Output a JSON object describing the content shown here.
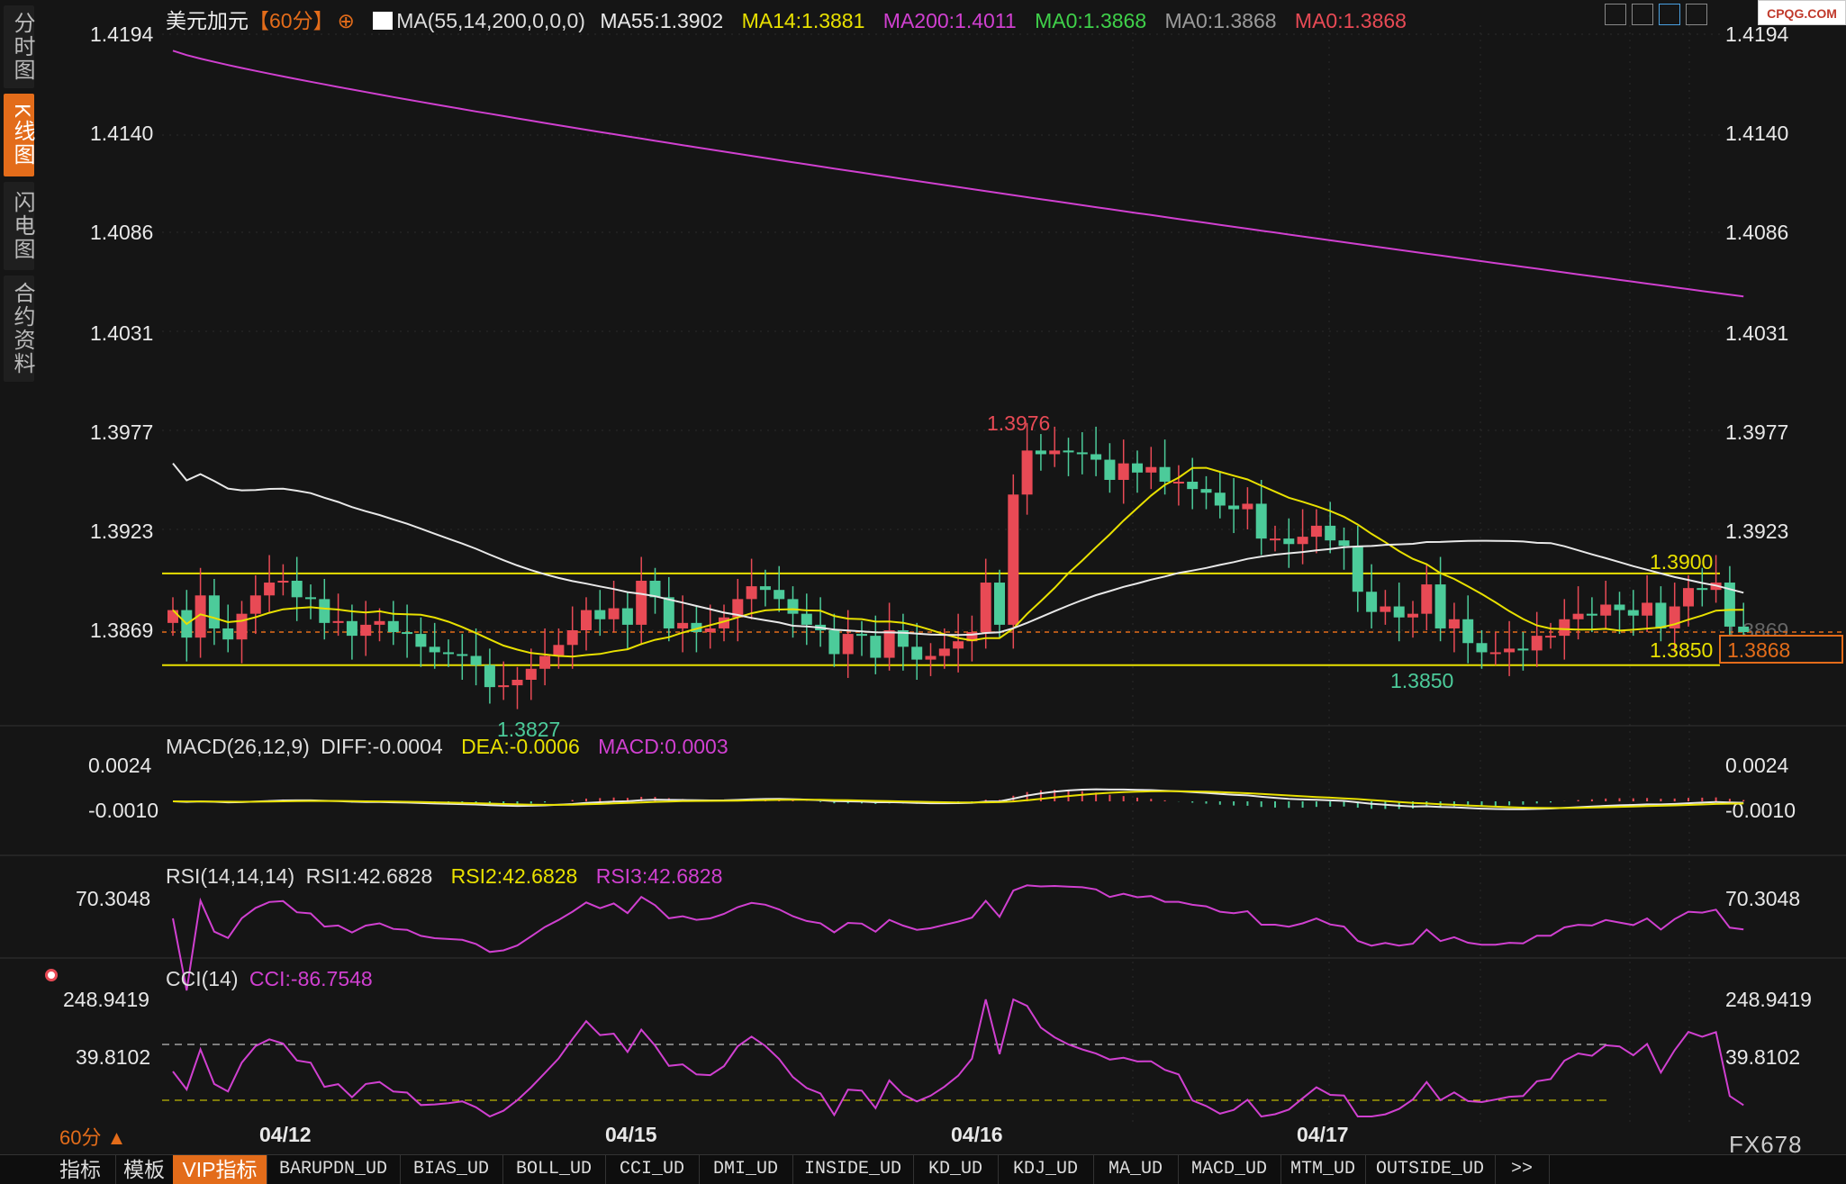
{
  "sidebar": {
    "items": [
      {
        "label": "分时图",
        "active": false
      },
      {
        "label": "K线图",
        "active": true
      },
      {
        "label": "闪电图",
        "active": false
      },
      {
        "label": "合约资料",
        "active": false
      }
    ]
  },
  "header": {
    "symbol": "美元加元",
    "period": "【60分】",
    "ma_params": "MA(55,14,200,0,0,0)",
    "ma55": "MA55:1.3902",
    "ma14": "MA14:1.3881",
    "ma200": "MA200:1.4011",
    "ma0_a": "MA0:1.3868",
    "ma0_b": "MA0:1.3868",
    "ma0_c": "MA0:1.3868"
  },
  "toolbar_icons": [
    "grid-icon",
    "list-icon",
    "chart-toggle-icon",
    "expand-icon"
  ],
  "logo": "CPQG.COM",
  "price_axis": {
    "labels": [
      "1.4194",
      "1.4140",
      "1.4086",
      "1.4031",
      "1.3977",
      "1.3923",
      "1.3869"
    ],
    "values": [
      1.4194,
      1.414,
      1.4086,
      1.4031,
      1.3977,
      1.3923,
      1.3869
    ]
  },
  "annotations": {
    "high": "1.3976",
    "low": "1.3827",
    "low2": "1.3850",
    "line_upper": "1.3900",
    "line_lower": "1.3850",
    "current": "1.3868"
  },
  "macd": {
    "legend": "MACD(26,12,9)",
    "diff": "DIFF:-0.0004",
    "dea": "DEA:-0.0006",
    "macd": "MACD:0.0003",
    "axis": [
      "0.0024",
      "-0.0010"
    ]
  },
  "rsi": {
    "legend": "RSI(14,14,14)",
    "rsi1": "RSI1:42.6828",
    "rsi2": "RSI2:42.6828",
    "rsi3": "RSI3:42.6828",
    "axis": [
      "70.3048"
    ]
  },
  "cci": {
    "legend": "CCI(14)",
    "cci": "CCI:-86.7548",
    "axis": [
      "248.9419",
      "39.8102"
    ]
  },
  "dates": [
    "04/12",
    "04/15",
    "04/16",
    "04/17"
  ],
  "period_label": "60分 ▲",
  "footer_mark": "FX678",
  "tabs": [
    "指标",
    "模板",
    "VIP指标",
    "BARUPDN_UD",
    "BIAS_UD",
    "BOLL_UD",
    "CCI_UD",
    "DMI_UD",
    "INSIDE_UD",
    "KD_UD",
    "KDJ_UD",
    "MA_UD",
    "MACD_UD",
    "MTM_UD",
    "OUTSIDE_UD",
    ">>"
  ],
  "colors": {
    "up": "#e84a55",
    "down": "#4ccb9a",
    "ma14": "#e8e000",
    "ma55": "#e8e8e8",
    "ma200": "#d040d0",
    "accent": "#e36c1a"
  },
  "chart_data": {
    "type": "candlestick",
    "closes": [
      1.388,
      1.3865,
      1.3888,
      1.387,
      1.3864,
      1.3878,
      1.3888,
      1.3895,
      1.3896,
      1.3887,
      1.3886,
      1.3873,
      1.3874,
      1.3866,
      1.3872,
      1.3874,
      1.3868,
      1.3867,
      1.386,
      1.3857,
      1.3856,
      1.3855,
      1.385,
      1.3838,
      1.3839,
      1.3842,
      1.3848,
      1.3855,
      1.3861,
      1.3869,
      1.388,
      1.3875,
      1.3881,
      1.3872,
      1.3896,
      1.3887,
      1.387,
      1.3873,
      1.3868,
      1.387,
      1.3876,
      1.3886,
      1.3893,
      1.3891,
      1.3886,
      1.3878,
      1.3872,
      1.3869,
      1.3856,
      1.3867,
      1.3866,
      1.3854,
      1.3869,
      1.386,
      1.3853,
      1.3855,
      1.3859,
      1.3863,
      1.3868,
      1.3895,
      1.3872,
      1.3943,
      1.3967,
      1.3965,
      1.3967,
      1.3966,
      1.3965,
      1.3962,
      1.3951,
      1.396,
      1.3955,
      1.3958,
      1.395,
      1.395,
      1.3946,
      1.3944,
      1.3937,
      1.3935,
      1.3938,
      1.3919,
      1.3919,
      1.3916,
      1.392,
      1.3926,
      1.3918,
      1.3915,
      1.389,
      1.3879,
      1.3882,
      1.3876,
      1.3878,
      1.3894,
      1.387,
      1.3875,
      1.3862,
      1.3857,
      1.3857,
      1.3859,
      1.3858,
      1.3866,
      1.3866,
      1.3875,
      1.3878,
      1.3877,
      1.3883,
      1.388,
      1.3877,
      1.3884,
      1.387,
      1.3882,
      1.3892,
      1.3891,
      1.3895,
      1.3871,
      1.3868
    ]
  }
}
